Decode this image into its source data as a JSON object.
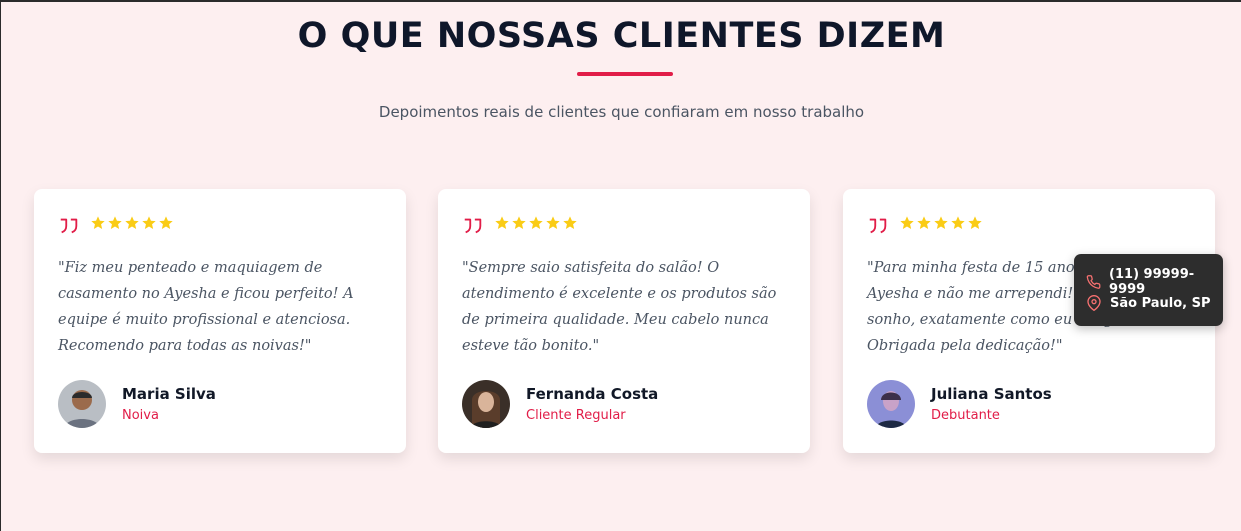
{
  "section": {
    "title": "O QUE NOSSAS CLIENTES DIZEM",
    "subtitle": "Depoimentos reais de clientes que confiaram em nosso trabalho"
  },
  "colors": {
    "accent": "#e11d48",
    "star": "#facc15",
    "background": "#fdeff0"
  },
  "testimonials": [
    {
      "rating": 5,
      "text": "\"Fiz meu penteado e maquiagem de casamento no Ayesha e ficou perfeito! A equipe é muito profissional e atenciosa. Recomendo para todas as noivas!\"",
      "name": "Maria Silva",
      "role": "Noiva"
    },
    {
      "rating": 5,
      "text": "\"Sempre saio satisfeita do salão! O atendimento é excelente e os produtos são de primeira qualidade. Meu cabelo nunca esteve tão bonito.\"",
      "name": "Fernanda Costa",
      "role": "Cliente Regular"
    },
    {
      "rating": 5,
      "text": "\"Para minha festa de 15 anos escolhi o Ayesha e não me arrependi! Ficou um sonho, exatamente como eu imaginava. Obrigada pela dedicação!\"",
      "name": "Juliana Santos",
      "role": "Debutante"
    }
  ],
  "contact_tooltip": {
    "phone": "(11) 99999-9999",
    "location": "São Paulo, SP",
    "phone_icon": "phone-icon",
    "location_icon": "map-pin-icon"
  }
}
